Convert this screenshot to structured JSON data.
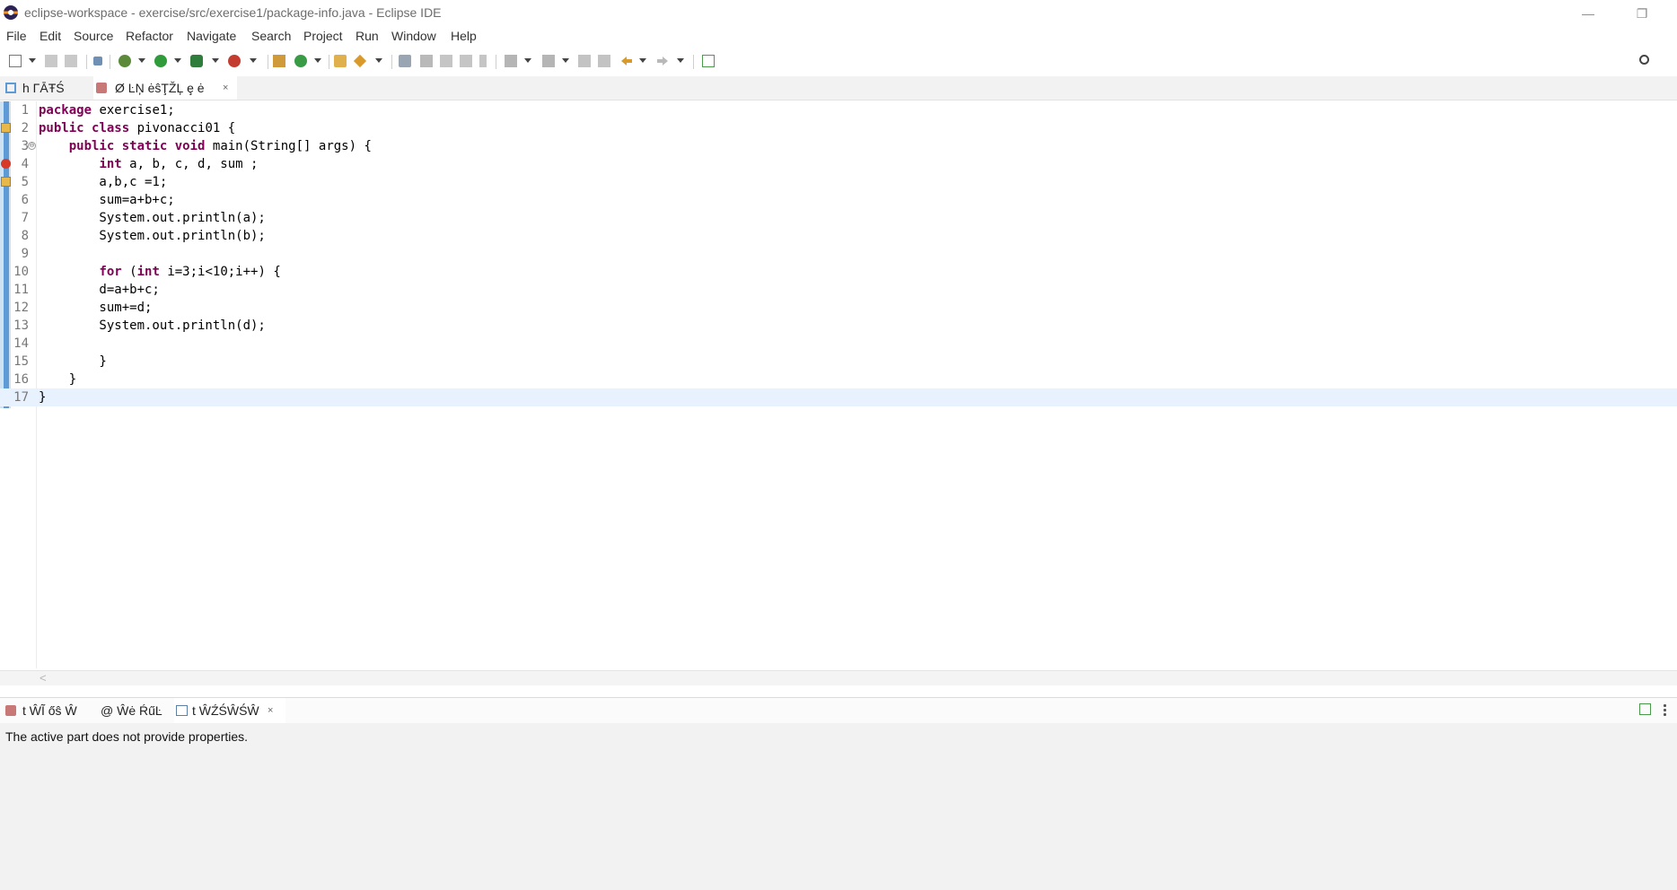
{
  "window": {
    "title": "eclipse-workspace - exercise/src/exercise1/package-info.java - Eclipse IDE",
    "minimize_glyph": "—",
    "restore_glyph": "❐"
  },
  "menu": [
    "File",
    "Edit",
    "Source",
    "Refactor",
    "Navigate",
    "Search",
    "Project",
    "Run",
    "Window",
    "Help"
  ],
  "toolbar_icons": [
    "new-icon",
    "save-icon",
    "save-all-icon",
    "skip-breakpoints-icon",
    "debug-icon",
    "run-icon",
    "coverage-icon",
    "external-tools-icon",
    "new-java-project-icon",
    "new-class-icon",
    "open-type-icon",
    "search-icon",
    "toggle-mark-occurrences-icon",
    "block-selection-icon",
    "show-whitespace-icon",
    "next-annotation-icon",
    "previous-annotation-icon",
    "last-edit-icon",
    "back-icon",
    "forward-icon",
    "pin-editor-icon",
    "quick-access-search-icon"
  ],
  "editor_tabs": [
    {
      "label": "h ΓĀŦŚ",
      "close": ""
    },
    {
      "label": "Ø ĿŅ ėŝŢŽĻ ȩ ė",
      "close": "×"
    }
  ],
  "code_lines": [
    {
      "num": "1",
      "text": "package exercise1;"
    },
    {
      "num": "2",
      "text": "public class pivonacci01 {"
    },
    {
      "num": "3",
      "text": "    public static void main(String[] args) {"
    },
    {
      "num": "4",
      "text": "        int a, b, c, d, sum ;"
    },
    {
      "num": "5",
      "text": "        a,b,c =1;"
    },
    {
      "num": "6",
      "text": "        sum=a+b+c;"
    },
    {
      "num": "7",
      "text": "        System.out.println(a);"
    },
    {
      "num": "8",
      "text": "        System.out.println(b);"
    },
    {
      "num": "9",
      "text": ""
    },
    {
      "num": "10",
      "text": "        for (int i=3;i<10;i++) {"
    },
    {
      "num": "11",
      "text": "        d=a+b+c;"
    },
    {
      "num": "12",
      "text": "        sum+=d;"
    },
    {
      "num": "13",
      "text": "        System.out.println(d);"
    },
    {
      "num": "14",
      "text": ""
    },
    {
      "num": "15",
      "text": "        }"
    },
    {
      "num": "16",
      "text": "    }"
    },
    {
      "num": "17",
      "text": "}"
    }
  ],
  "fold_glyph": "⊖",
  "hscroll_arrow": "<",
  "bottom_tabs": [
    {
      "label": "t ŴĨ őŝ Ŵ"
    },
    {
      "label": "@ Ŵė ŔűĿ"
    },
    {
      "label": "t ŴŹŚŴŚŴ",
      "close": "×"
    }
  ],
  "properties_message": "The active part does not provide properties.",
  "colors": {
    "keyword": "#7f0055",
    "accent": "#5e9bd6"
  }
}
